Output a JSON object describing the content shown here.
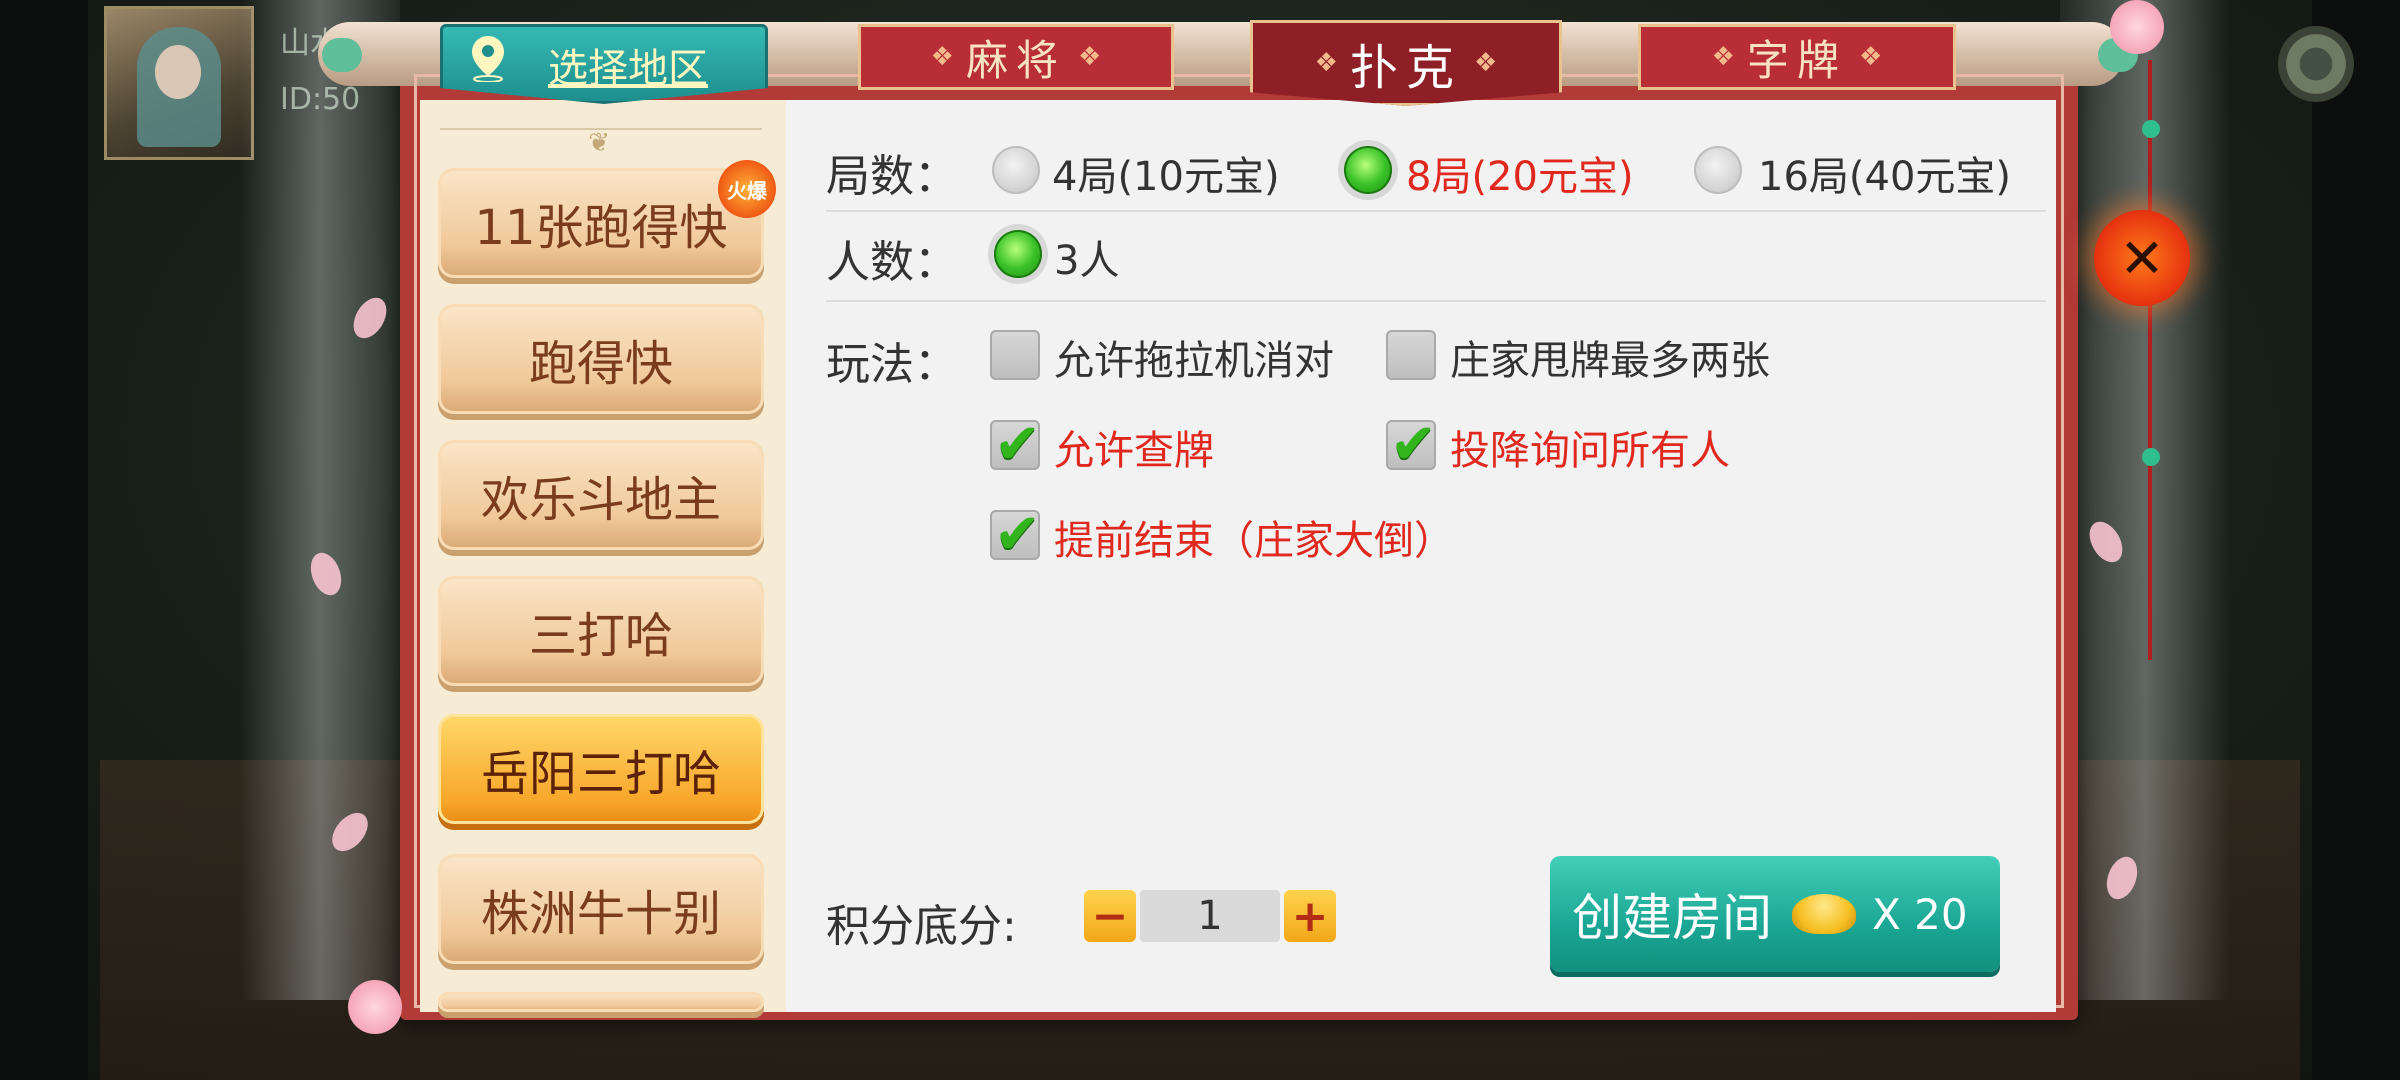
{
  "user": {
    "name": "山水",
    "id": "ID:50"
  },
  "region": {
    "label": "选择地区"
  },
  "tabs": [
    {
      "label": "麻将",
      "active": false
    },
    {
      "label": "扑克",
      "active": true
    },
    {
      "label": "字牌",
      "active": false
    }
  ],
  "games": [
    {
      "label": "11张跑得快",
      "badge": "火爆"
    },
    {
      "label": "跑得快"
    },
    {
      "label": "欢乐斗地主"
    },
    {
      "label": "三打哈"
    },
    {
      "label": "岳阳三打哈",
      "selected": true
    },
    {
      "label": "株洲牛十别"
    }
  ],
  "rounds": {
    "label": "局数：",
    "options": [
      {
        "text": "4局(10元宝)",
        "selected": false
      },
      {
        "text": "8局(20元宝)",
        "selected": true
      },
      {
        "text": "16局(40元宝)",
        "selected": false
      }
    ]
  },
  "players": {
    "label": "人数：",
    "options": [
      {
        "text": "3人",
        "selected": true
      }
    ]
  },
  "rules": {
    "label": "玩法：",
    "options": [
      {
        "text": "允许拖拉机消对",
        "checked": false
      },
      {
        "text": "庄家甩牌最多两张",
        "checked": false
      },
      {
        "text": "允许查牌",
        "checked": true
      },
      {
        "text": "投降询问所有人",
        "checked": true
      },
      {
        "text": "提前结束（庄家大倒）",
        "checked": true
      }
    ]
  },
  "score": {
    "label": "积分底分:",
    "minus": "−",
    "value": "1",
    "plus": "+"
  },
  "create": {
    "label": "创建房间",
    "cost": "X 20"
  },
  "close": {
    "symbol": "✕"
  },
  "colors": {
    "selected_text": "#e0281e",
    "accent_teal": "#1aa694",
    "frame_red": "#b23a37"
  }
}
